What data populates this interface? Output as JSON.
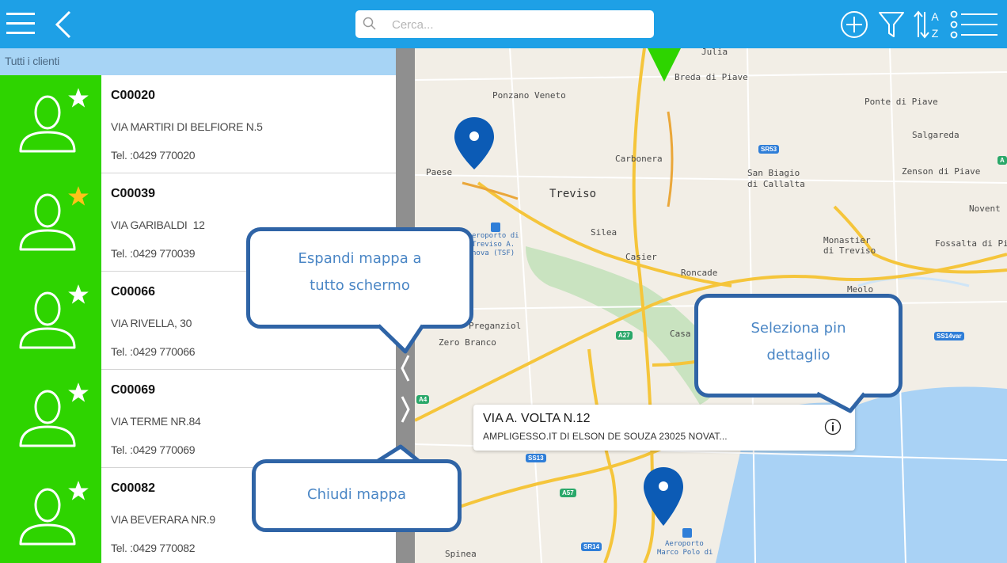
{
  "topbar": {
    "menu_icon": "hamburger-menu-icon",
    "back_icon": "chevron-left-icon",
    "search": {
      "placeholder": "Cerca...",
      "value": ""
    },
    "add_icon": "plus-circle-icon",
    "filter_icon": "funnel-filter-icon",
    "sort_icon": "sort-az-icon",
    "list_icon": "list-view-icon",
    "color": "#1ea0e6"
  },
  "list": {
    "header": "Tutti i clienti",
    "clients": [
      {
        "code": "C00020",
        "address": "VIA MARTIRI DI BELFIORE N.5",
        "phone": "Tel. :0429 770020",
        "favorite": false
      },
      {
        "code": "C00039",
        "address": "VIA GARIBALDI  12",
        "phone": "Tel. :0429 770039",
        "favorite": true
      },
      {
        "code": "C00066",
        "address": "VIA RIVELLA, 30",
        "phone": "Tel. :0429 770066",
        "favorite": false
      },
      {
        "code": "C00069",
        "address": "VIA TERME NR.84",
        "phone": "Tel. :0429 770069",
        "favorite": false
      },
      {
        "code": "C00082",
        "address": "VIA BEVERARA NR.9",
        "phone": "Tel. :0429 770082",
        "favorite": false
      }
    ],
    "avatar_color": "#2ed400",
    "favorite_color": "#ffc21a"
  },
  "map": {
    "places": {
      "breda": "Breda di Piave",
      "ponzano": "Ponzano Veneto",
      "ponte_piave": "Ponte di Piave",
      "salgareda": "Salgareda",
      "carbonera": "Carbonera",
      "paese": "Paese",
      "treviso": "Treviso",
      "san_biagio": "San Biagio",
      "callalta": "di Callalta",
      "zenson": "Zenson di Piave",
      "noventa": "Novent",
      "aeroporto_treviso_1": "eroporto di",
      "aeroporto_treviso_2": "Treviso A.",
      "aeroporto_treviso_3": "nova (TSF)",
      "silea": "Silea",
      "casier": "Casier",
      "monastier": "Monastier",
      "monastier2": "di Treviso",
      "fossalta": "Fossalta di Pi",
      "roncade": "Roncade",
      "meolo": "Meolo",
      "preganziol": "Preganziol",
      "zero_branco": "Zero Branco",
      "casale": "Casa",
      "spinea": "Spinea",
      "aeroporto_venezia_1": "Aeroporto",
      "aeroporto_venezia_2": "Marco Polo di",
      "julia": "Julia"
    },
    "shields": {
      "sr53": "SR53",
      "a27": "A27",
      "ss14var": "SS14var",
      "a4": "A4",
      "ss13": "SS13",
      "a57": "A57",
      "sr14": "SR14",
      "a_right": "A"
    },
    "callout": {
      "title": "VIA A. VOLTA N.12",
      "subtitle": "AMPLIGESSO.IT DI ELSON DE SOUZA 23025 NOVAT...",
      "info_icon": "info-circle-icon"
    },
    "pin_color": "#0c5bb5"
  },
  "annotations": {
    "expand": {
      "line1": "Espandi mappa a",
      "line2": "tutto schermo"
    },
    "select_pin": {
      "line1": "Seleziona pin",
      "line2": "dettaglio"
    },
    "close": {
      "line1": "Chiudi mappa"
    }
  }
}
